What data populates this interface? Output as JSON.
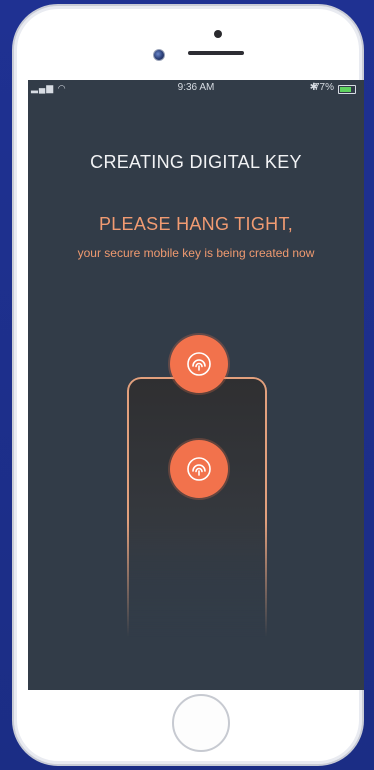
{
  "status_bar": {
    "signal": "▏▎▍ ☰",
    "time": "9:36 AM",
    "bluetooth": "✱",
    "battery_pct": "77%",
    "battery_level": 0.77
  },
  "screen": {
    "title": "CREATING DIGITAL KEY",
    "subtitle": "PLEASE HANG TIGHT,",
    "message": "your secure mobile key is being created now"
  },
  "colors": {
    "accent": "#f2724c",
    "accent_text": "#f19b72",
    "screen_bg": "#323c48",
    "page_bg": "#1d2f8c"
  },
  "icons": {
    "key_badge": "key-fingerprint-icon"
  }
}
